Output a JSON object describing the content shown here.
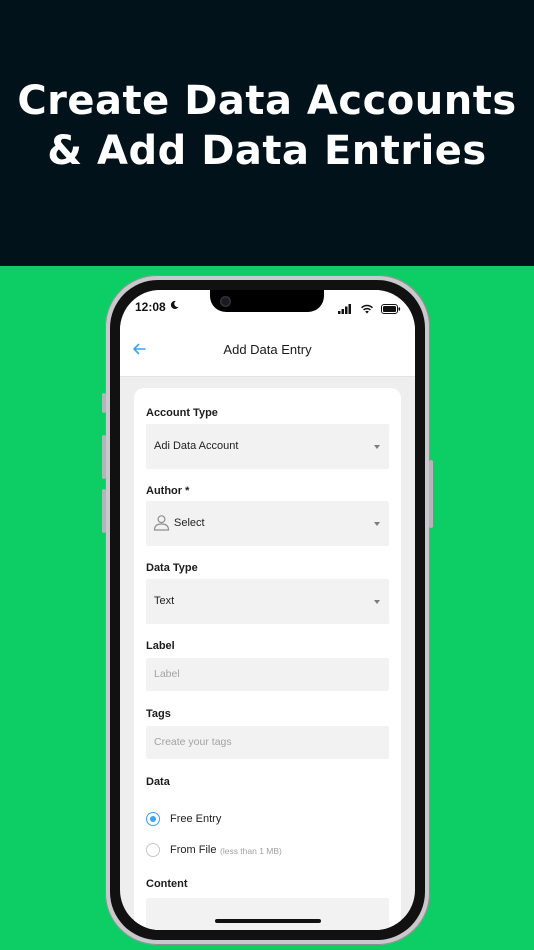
{
  "hero": {
    "line1": "Create Data Accounts",
    "line2": "& Add Data Entries"
  },
  "status_bar": {
    "time": "12:08",
    "icons": [
      "moon-icon",
      "signal-icon",
      "wifi-icon",
      "battery-icon"
    ]
  },
  "nav": {
    "title": "Add Data Entry",
    "back_icon": "arrow-left-icon"
  },
  "form": {
    "account_type": {
      "label": "Account Type",
      "value": "Adi Data Account"
    },
    "author": {
      "label": "Author *",
      "value": "Select",
      "icon": "person-icon"
    },
    "data_type": {
      "label": "Data Type",
      "value": "Text"
    },
    "label_field": {
      "label": "Label",
      "placeholder": "Label"
    },
    "tags": {
      "label": "Tags",
      "placeholder": "Create your tags"
    },
    "data": {
      "label": "Data",
      "options": [
        {
          "label": "Free Entry",
          "selected": true
        },
        {
          "label": "From File",
          "hint": "(less than 1 MB)",
          "selected": false
        }
      ]
    },
    "content": {
      "label": "Content"
    }
  },
  "colors": {
    "hero_bg": "#02121b",
    "page_bg": "#0cce65",
    "accent": "#3ea2ef"
  }
}
